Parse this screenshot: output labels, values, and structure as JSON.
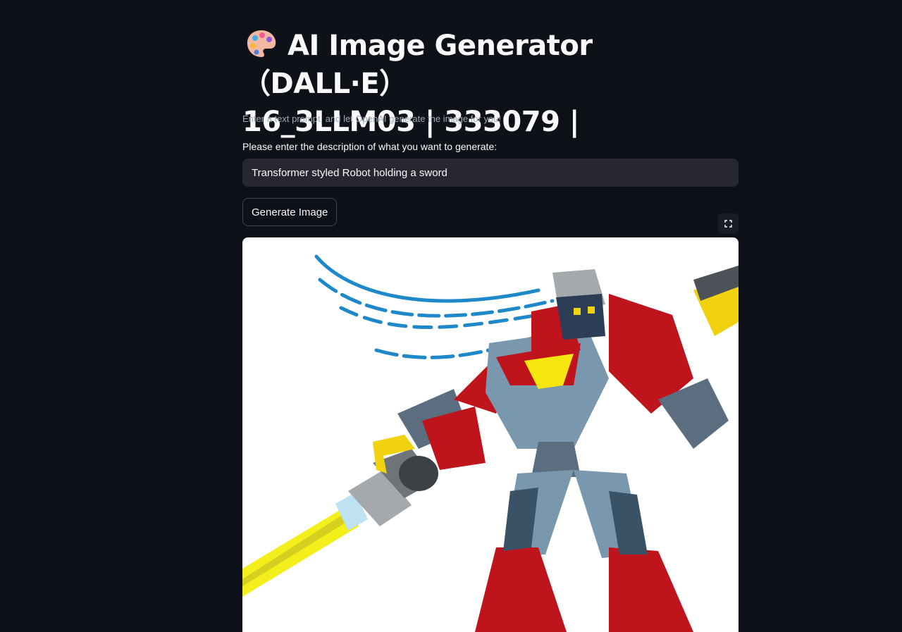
{
  "header": {
    "title_line1": "AI Image Generator（DALL·E）",
    "title_line2": "16_3LLM03 | 333079 |",
    "icon": "artist-palette-icon",
    "subtitle": "Enter a text prompt, and let OpenAI generate the image for you!"
  },
  "form": {
    "prompt_label": "Please enter the description of what you want to generate:",
    "prompt_value": "Transformer styled Robot holding a sword",
    "generate_label": "Generate Image"
  },
  "output": {
    "fullscreen_icon": "fullscreen-icon"
  },
  "theme": {
    "background": "#0e1117",
    "input_background": "#262730",
    "text": "#fafafa",
    "muted_text": "#a3a8b8"
  }
}
